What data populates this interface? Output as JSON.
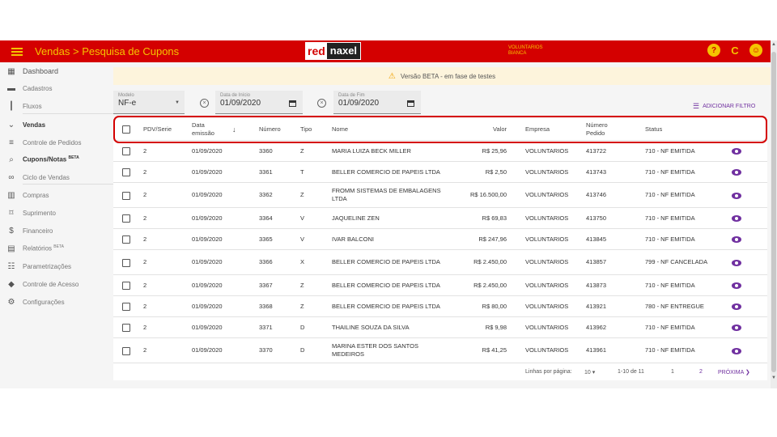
{
  "header": {
    "title": "Vendas > Pesquisa de Cupons",
    "logo_red": "red",
    "logo_dark": "naxel",
    "user_line1": "VOLUNTARIOS",
    "user_line2": "BIANCA",
    "icons": [
      "help-icon",
      "refresh-icon",
      "account-icon"
    ],
    "help_glyph": "?",
    "refresh_glyph": "C",
    "account_glyph": "☺"
  },
  "sidebar": {
    "items": [
      {
        "label": "Dashboard",
        "icon": "dashboard-icon",
        "glyph": "▦"
      },
      {
        "label": "Cadastros",
        "icon": "folder-icon",
        "glyph": "▬"
      },
      {
        "label": "Fluxos",
        "icon": "columns-icon",
        "glyph": "┃"
      },
      {
        "label": "Vendas",
        "icon": "chevron-down-icon",
        "glyph": "⌄"
      },
      {
        "label": "Controle de Pedidos",
        "icon": "list-icon",
        "glyph": "≡"
      },
      {
        "label": "Cupons/Notas",
        "sup": "BETA",
        "icon": "search-icon",
        "glyph": "⌕"
      },
      {
        "label": "Ciclo de Vendas",
        "icon": "infinity-icon",
        "glyph": "∞"
      },
      {
        "label": "Compras",
        "icon": "store-icon",
        "glyph": "▥"
      },
      {
        "label": "Suprimento",
        "icon": "box-icon",
        "glyph": "⌑"
      },
      {
        "label": "Financeiro",
        "icon": "dollar-icon",
        "glyph": "$"
      },
      {
        "label": "Relatórios",
        "sup": "BETA",
        "icon": "print-icon",
        "glyph": "▤"
      },
      {
        "label": "Parametrizações",
        "icon": "sliders-icon",
        "glyph": "☷"
      },
      {
        "label": "Controle de Acesso",
        "icon": "shield-icon",
        "glyph": "◆"
      },
      {
        "label": "Configurações",
        "icon": "gear-icon",
        "glyph": "⚙"
      }
    ]
  },
  "banner": {
    "text": "Versão BETA - em fase de testes",
    "icon": "warning-icon",
    "glyph": "⚠"
  },
  "filters": {
    "modelo": {
      "label": "Modelo",
      "value": "NF-e"
    },
    "inicio": {
      "label": "Data de Início",
      "value": "01/09/2020"
    },
    "fim": {
      "label": "Data de Fim",
      "value": "01/09/2020"
    },
    "clear_glyph": "×",
    "caret_glyph": "▼",
    "add_filter": "ADICIONAR FILTRO",
    "filter_glyph": "☰"
  },
  "table": {
    "headers": {
      "pdv": "PDV/Serie",
      "data1": "Data",
      "data2": "emissão",
      "sort_glyph": "↓",
      "numero": "Número",
      "tipo": "Tipo",
      "nome": "Nome",
      "valor": "Valor",
      "empresa": "Empresa",
      "pedido1": "Número",
      "pedido2": "Pedido",
      "status": "Status"
    },
    "rows": [
      {
        "pdv": "2",
        "data": "01/09/2020",
        "numero": "3360",
        "tipo": "Z",
        "nome": "MARIA LUIZA BECK MILLER",
        "valor": "R$ 25,96",
        "empresa": "VOLUNTARIOS",
        "pedido": "413722",
        "status": "710 - NF EMITIDA"
      },
      {
        "pdv": "2",
        "data": "01/09/2020",
        "numero": "3361",
        "tipo": "T",
        "nome": "BELLER COMERCIO DE PAPEIS LTDA",
        "valor": "R$ 2,50",
        "empresa": "VOLUNTARIOS",
        "pedido": "413743",
        "status": "710 - NF EMITIDA"
      },
      {
        "pdv": "2",
        "data": "01/09/2020",
        "numero": "3362",
        "tipo": "Z",
        "nome": "FROMM SISTEMAS DE EMBALAGENS LTDA",
        "valor": "R$ 16.500,00",
        "empresa": "VOLUNTARIOS",
        "pedido": "413746",
        "status": "710 - NF EMITIDA"
      },
      {
        "pdv": "2",
        "data": "01/09/2020",
        "numero": "3364",
        "tipo": "V",
        "nome": "JAQUELINE ZEN",
        "valor": "R$ 69,83",
        "empresa": "VOLUNTARIOS",
        "pedido": "413750",
        "status": "710 - NF EMITIDA"
      },
      {
        "pdv": "2",
        "data": "01/09/2020",
        "numero": "3365",
        "tipo": "V",
        "nome": "IVAR BALCONI",
        "valor": "R$ 247,96",
        "empresa": "VOLUNTARIOS",
        "pedido": "413845",
        "status": "710 - NF EMITIDA"
      },
      {
        "pdv": "2",
        "data": "01/09/2020",
        "numero": "3366",
        "tipo": "X",
        "nome": "BELLER COMERCIO DE PAPEIS LTDA",
        "valor": "R$ 2.450,00",
        "empresa": "VOLUNTARIOS",
        "pedido": "413857",
        "status": "799 - NF CANCELADA"
      },
      {
        "pdv": "2",
        "data": "01/09/2020",
        "numero": "3367",
        "tipo": "Z",
        "nome": "BELLER COMERCIO DE PAPEIS LTDA",
        "valor": "R$ 2.450,00",
        "empresa": "VOLUNTARIOS",
        "pedido": "413873",
        "status": "710 - NF EMITIDA"
      },
      {
        "pdv": "2",
        "data": "01/09/2020",
        "numero": "3368",
        "tipo": "Z",
        "nome": "BELLER COMERCIO DE PAPEIS LTDA",
        "valor": "R$ 80,00",
        "empresa": "VOLUNTARIOS",
        "pedido": "413921",
        "status": "780 - NF ENTREGUE"
      },
      {
        "pdv": "2",
        "data": "01/09/2020",
        "numero": "3371",
        "tipo": "D",
        "nome": "THAILINE SOUZA DA SILVA",
        "valor": "R$ 9,98",
        "empresa": "VOLUNTARIOS",
        "pedido": "413962",
        "status": "710 - NF EMITIDA"
      },
      {
        "pdv": "2",
        "data": "01/09/2020",
        "numero": "3370",
        "tipo": "D",
        "nome": "MARINA ESTER DOS SANTOS MEDEIROS",
        "valor": "R$ 41,25",
        "empresa": "VOLUNTARIOS",
        "pedido": "413961",
        "status": "710 - NF EMITIDA"
      }
    ]
  },
  "pagination": {
    "rows_label": "Linhas por página:",
    "rows_value": "10",
    "caret_glyph": "▾",
    "range": "1-10 de 11",
    "page1": "1",
    "page2": "2",
    "next": "PRÓXIMA",
    "next_glyph": "❯"
  },
  "colors": {
    "brand_red": "#d40000",
    "accent_yellow": "#f5c400",
    "accent_purple": "#7030a0"
  }
}
